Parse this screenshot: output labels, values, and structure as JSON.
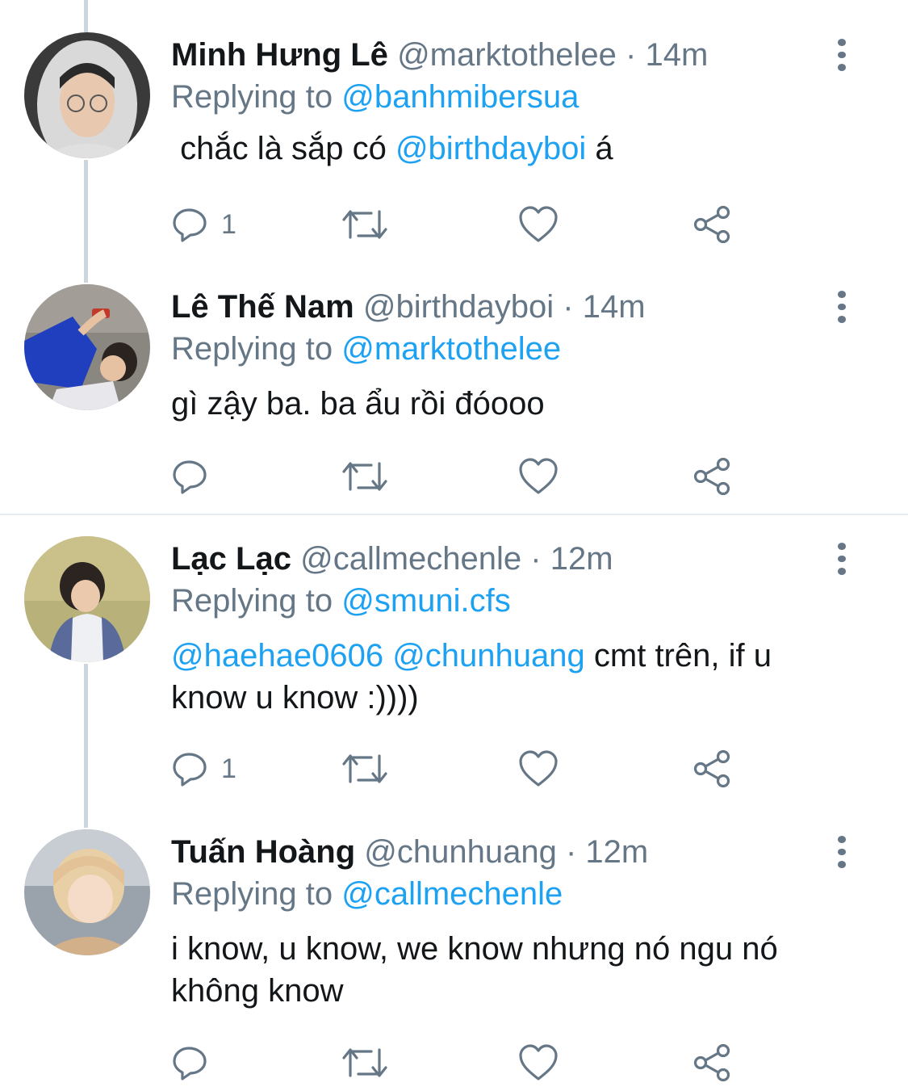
{
  "colors": {
    "mention": "#1da1f2",
    "muted": "#657786",
    "text": "#14171a",
    "thread_line": "#ccd6dd"
  },
  "tweets": [
    {
      "name": "Minh Hưng Lê",
      "handle": "@marktothelee",
      "time": "· 14m",
      "replying_prefix": "Replying to ",
      "replying_to": "@banhmibersua",
      "text_before": " chắc là sắp có ",
      "text_mention": "@birthdayboi",
      "text_after": " á",
      "reply_count": "1",
      "avatar": "hooded-person-avatar"
    },
    {
      "name": "Lê Thế Nam",
      "handle": "@birthdayboi",
      "time": "· 14m",
      "replying_prefix": "Replying to ",
      "replying_to": "@marktothelee",
      "text_plain": "gì zậy ba. ba ẩu rồi đóooo",
      "reply_count": "",
      "avatar": "person-lying-down-avatar"
    },
    {
      "name": "Lạc Lạc",
      "handle": "@callmechenle",
      "time": "· 12m",
      "replying_prefix": "Replying to ",
      "replying_to": "@smuni.cfs",
      "text_mention_1": "@haehae0606",
      "text_mention_2": "@chunhuang",
      "text_after": " cmt trên, if u know u know :))))",
      "reply_count": "1",
      "avatar": "smiling-person-avatar"
    },
    {
      "name": "Tuấn Hoàng",
      "handle": "@chunhuang",
      "time": "· 12m",
      "replying_prefix": "Replying to ",
      "replying_to": "@callmechenle",
      "text_plain": "i know, u know, we know nhưng nó ngu nó không know",
      "reply_count": "",
      "avatar": "blonde-person-avatar"
    }
  ]
}
